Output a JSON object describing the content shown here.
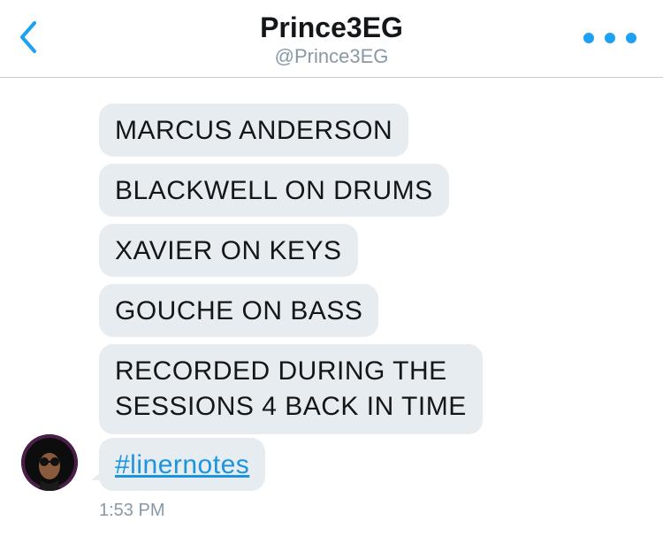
{
  "header": {
    "title": "Prince3EG",
    "handle": "@Prince3EG"
  },
  "messages": [
    {
      "text": "MARCUS ANDERSON"
    },
    {
      "text": "BLACKWELL ON DRUMS"
    },
    {
      "text": "XAVIER ON KEYS"
    },
    {
      "text": "GOUCHE ON BASS"
    },
    {
      "line1": "RECORDED DURING THE",
      "line2": "SESSIONS 4 BACK IN TIME"
    },
    {
      "text": "#linernotes"
    }
  ],
  "timestamp": "1:53 PM",
  "colors": {
    "accent": "#1da1f2",
    "bubble": "#e6ecf0",
    "link": "#1b95e0",
    "secondary_text": "#8899a6"
  },
  "icons": {
    "back": "chevron-left-icon",
    "more": "more-dots-icon"
  }
}
